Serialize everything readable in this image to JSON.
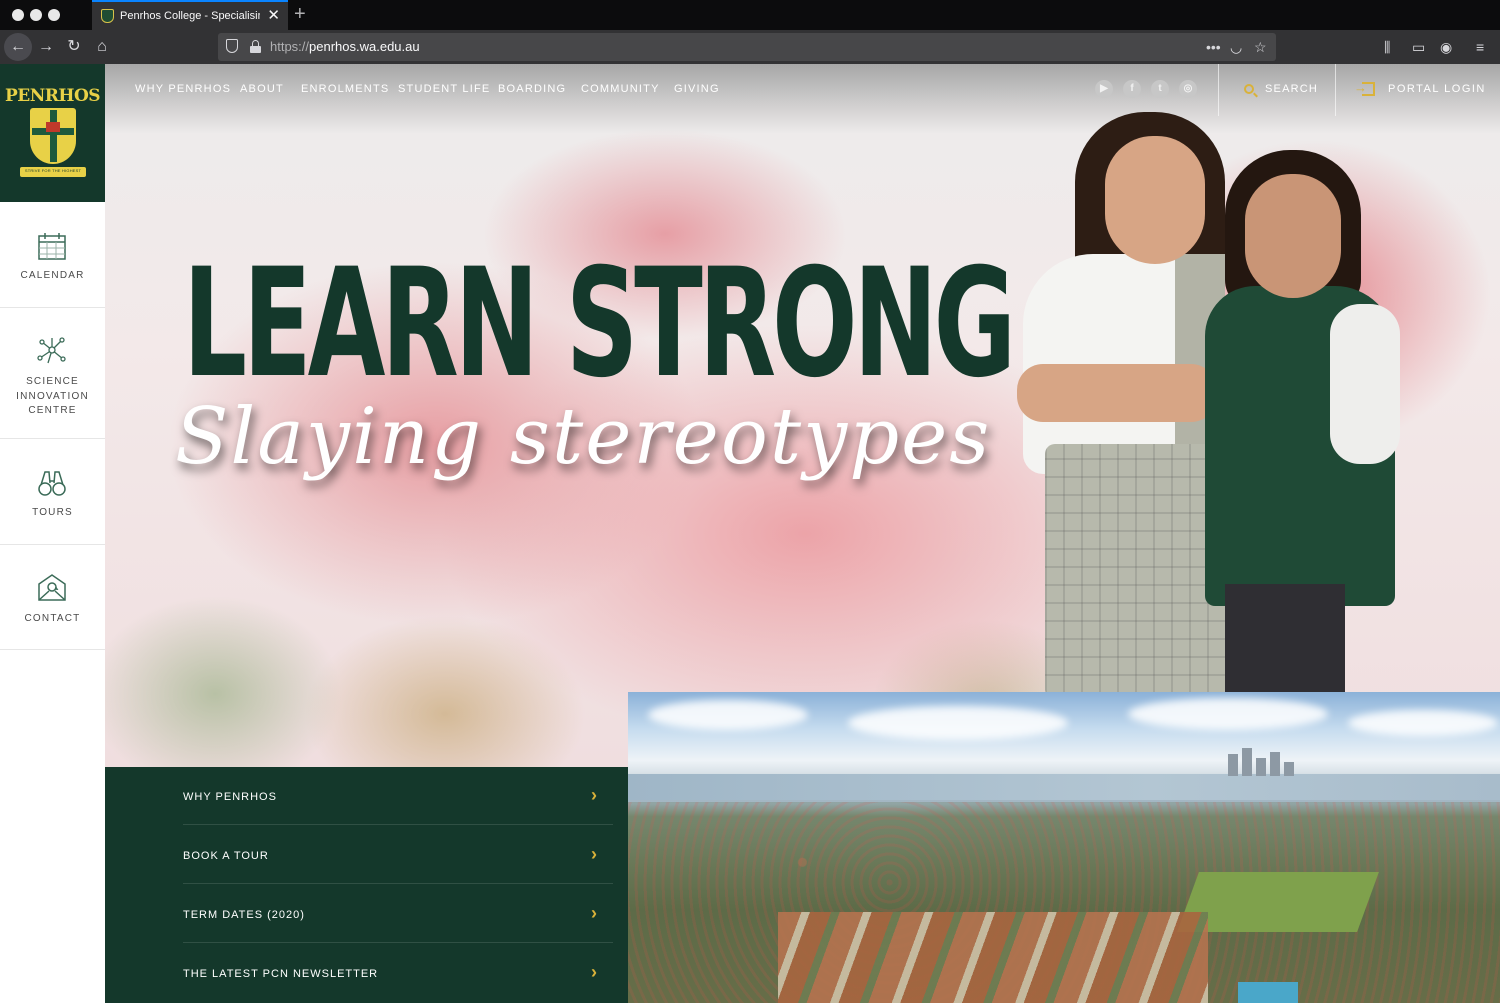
{
  "browser": {
    "tab_title": "Penrhos College - Specialising i",
    "tab_close": "✕",
    "new_tab": "+",
    "url_proto": "https://",
    "url_host": "penrhos.wa.edu.au",
    "icons": [
      "back-icon",
      "forward-icon",
      "reload-icon",
      "home-icon",
      "shield-icon",
      "lock-icon",
      "more-icon",
      "pocket-icon",
      "star-icon",
      "library-icon",
      "sidebar-icon",
      "account-icon",
      "menu-icon"
    ]
  },
  "topnav": {
    "items": [
      "WHY PENRHOS",
      "ABOUT",
      "ENROLMENTS",
      "STUDENT LIFE",
      "BOARDING",
      "COMMUNITY",
      "GIVING"
    ],
    "social": [
      "youtube-icon",
      "facebook-icon",
      "twitter-icon",
      "instagram-icon"
    ],
    "search_label": "SEARCH",
    "portal_label": "PORTAL LOGIN"
  },
  "logo": {
    "name": "PENRHOS",
    "motto": "STRIVE FOR THE HIGHEST"
  },
  "sidebar": {
    "items": [
      {
        "label": "CALENDAR",
        "icon": "calendar-icon"
      },
      {
        "label": "SCIENCE INNOVATION CENTRE",
        "icon": "molecule-icon"
      },
      {
        "label": "TOURS",
        "icon": "binoculars-icon"
      },
      {
        "label": "CONTACT",
        "icon": "envelope-icon"
      }
    ]
  },
  "hero": {
    "headline": "LEARN STRONG",
    "tagline": "Slaying stereotypes"
  },
  "quicklinks": {
    "items": [
      "WHY PENRHOS",
      "BOOK A TOUR",
      "TERM DATES (2020)",
      "THE LATEST PCN NEWSLETTER"
    ],
    "chevron": "›"
  },
  "colors": {
    "brand_green": "#14382b",
    "brand_gold": "#d9b23a",
    "crest_yellow": "#e8d147"
  }
}
